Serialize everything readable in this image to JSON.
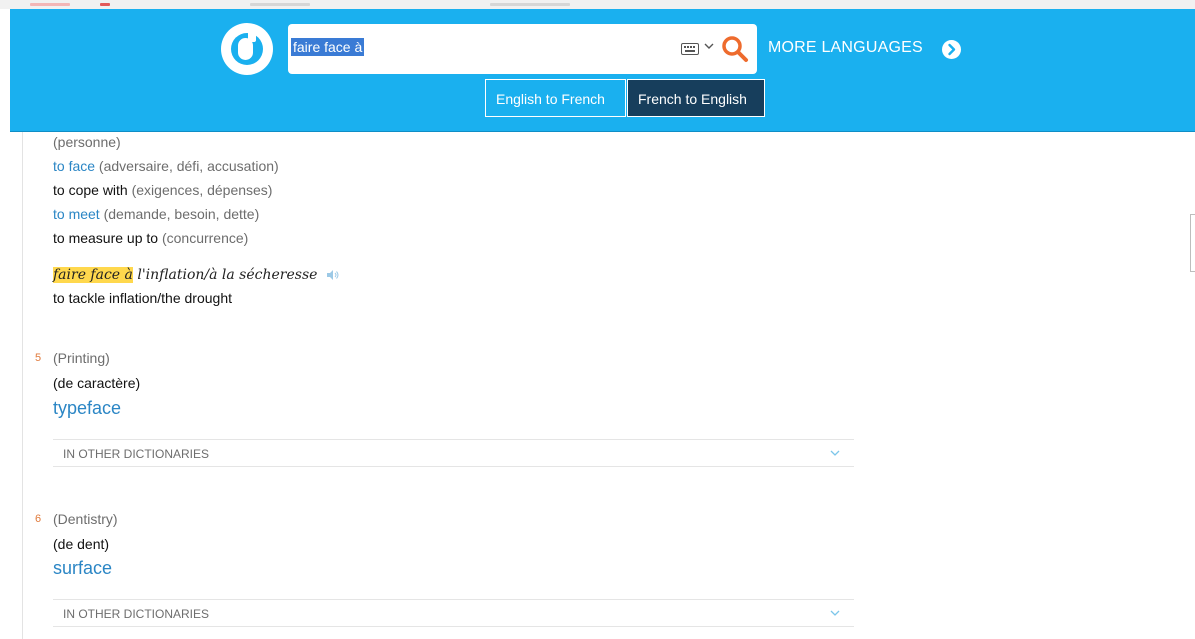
{
  "colors": {
    "header_bg": "#1ab0ef",
    "active_tab": "#173e5c",
    "link_blue": "#2b86c5",
    "number_orange": "#e07a3c",
    "highlight": "#ffd84d"
  },
  "search": {
    "query": "faire face à"
  },
  "header": {
    "more_languages": "MORE LANGUAGES"
  },
  "tabs": [
    {
      "label": "English to French"
    },
    {
      "label": "French to English"
    }
  ],
  "entry_top": {
    "context": "(personne)",
    "senses": [
      {
        "translation": "to face",
        "gloss": "(adversaire, défi, accusation)"
      },
      {
        "translation": "to cope with",
        "gloss": "(exigences, dépenses)"
      },
      {
        "translation": "to meet",
        "gloss": "(demande, besoin, dette)"
      },
      {
        "translation": "to measure up to",
        "gloss": "(concurrence)"
      }
    ],
    "example": {
      "highlight": "faire face à",
      "rest": " l'inflation/à la sécheresse",
      "translation": "to tackle inflation/the drought"
    }
  },
  "sense5": {
    "number": "5",
    "domain": "(Printing)",
    "context": "(de caractère)",
    "translation": "typeface",
    "other_dicts": "IN OTHER DICTIONARIES"
  },
  "sense6": {
    "number": "6",
    "domain": "(Dentistry)",
    "context": "(de dent)",
    "translation": "surface",
    "other_dicts": "IN OTHER DICTIONARIES"
  },
  "icons": [
    "logo-icon",
    "keyboard-icon",
    "chevron-down-icon",
    "search-icon",
    "arrow-right-circle-icon",
    "speaker-icon"
  ]
}
